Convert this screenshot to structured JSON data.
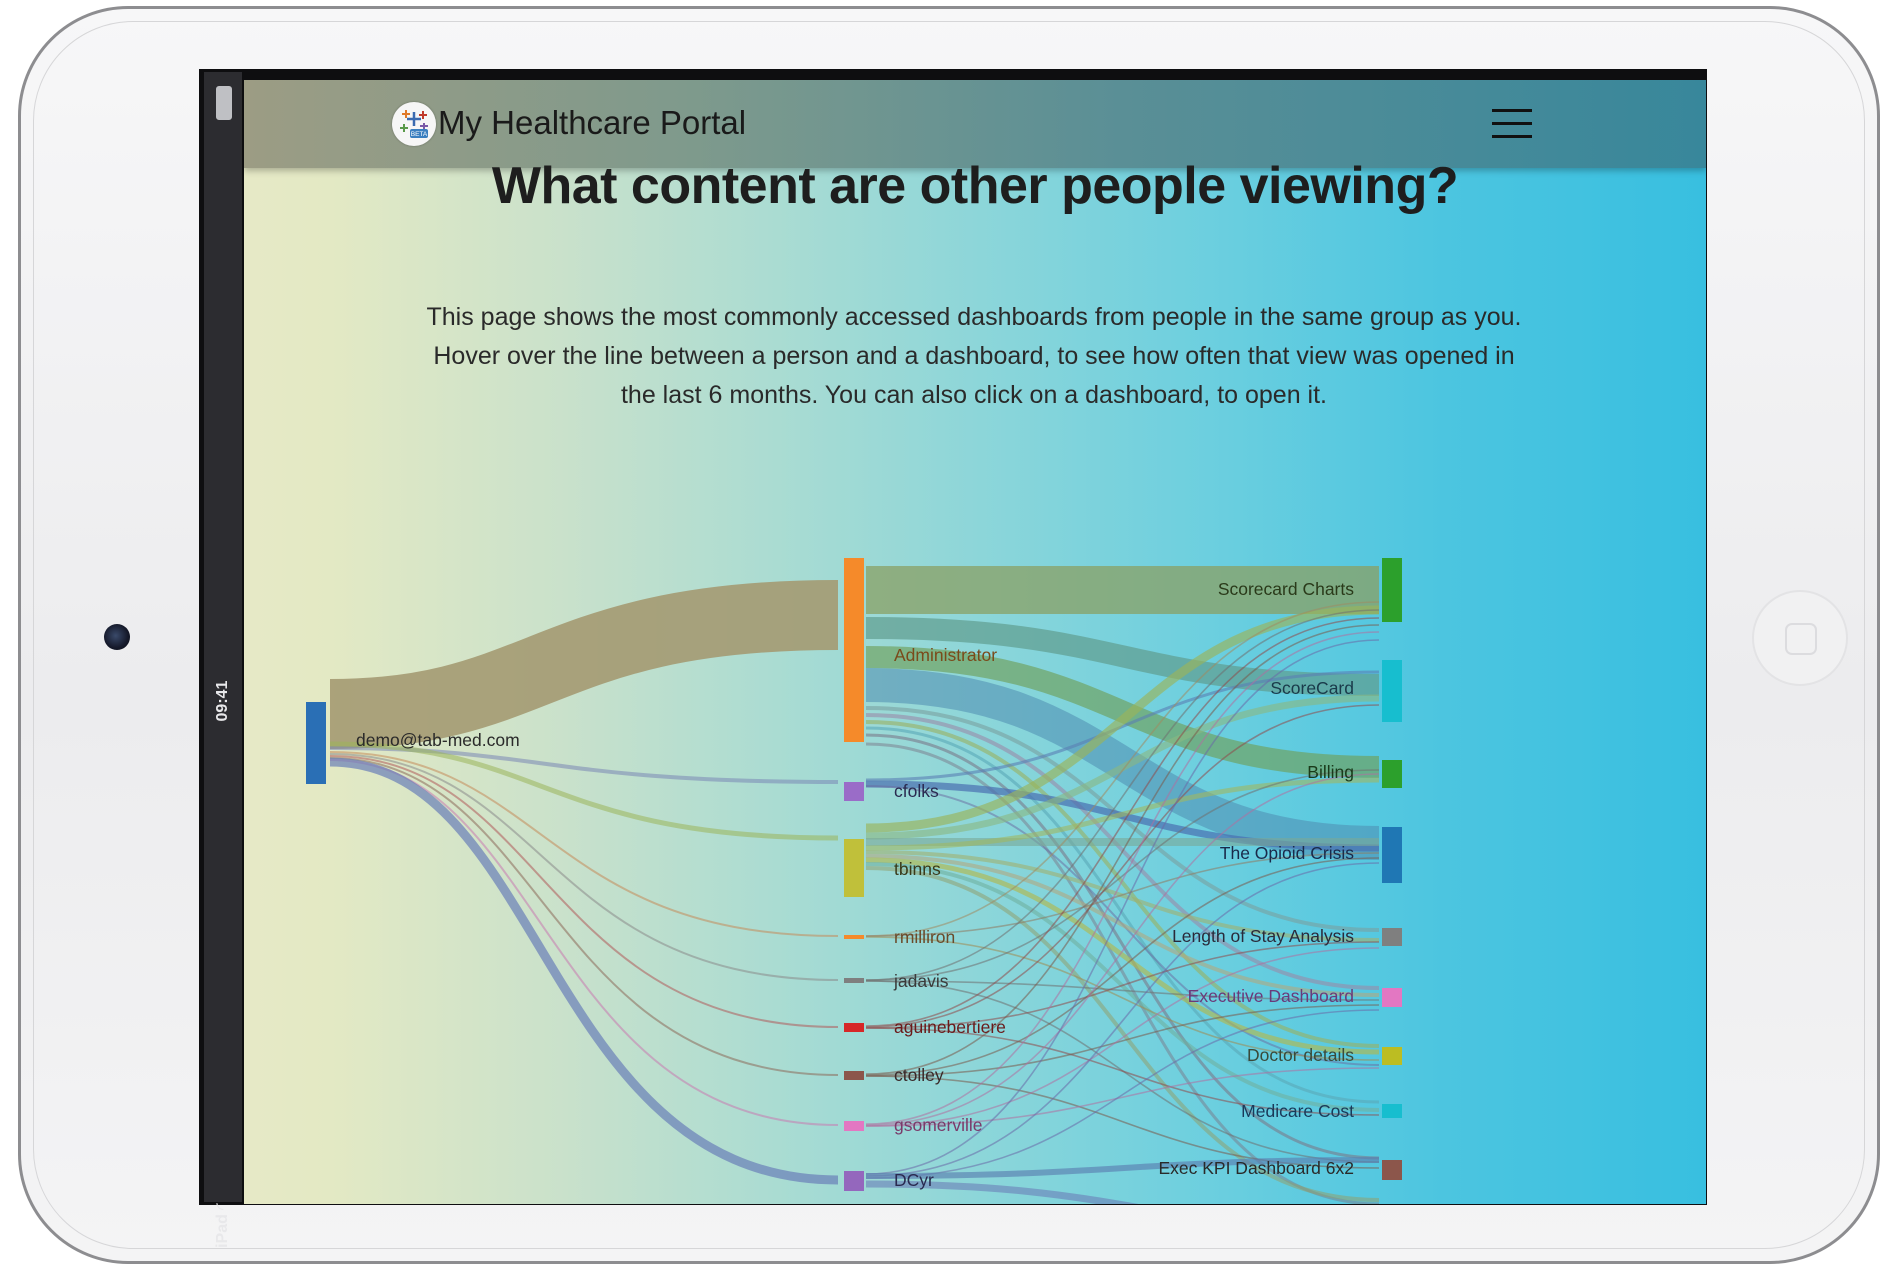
{
  "device": {
    "status_time": "09:41",
    "carrier": "iPad"
  },
  "header": {
    "brand": "My Healthcare Portal",
    "logo_badge": "BETA"
  },
  "page": {
    "title": "What content are other people viewing?",
    "description": "This page shows the most commonly accessed dashboards from people in the same group as you. Hover over the line between a person and a dashboard, to see how often that view was opened in the last 6 months. You can also click on a dashboard, to open it."
  },
  "sankey": {
    "source": {
      "label": "demo@tab-med.com",
      "color": "#2a6fb5"
    },
    "users": [
      {
        "label": "Administrator",
        "color": "#f58a2a"
      },
      {
        "label": "cfolks",
        "color": "#9a6cc8"
      },
      {
        "label": "tbinns",
        "color": "#c0c03a"
      },
      {
        "label": "rmilliron",
        "color": "#f58a2a"
      },
      {
        "label": "jadavis",
        "color": "#7f7f7f"
      },
      {
        "label": "aguinebertiere",
        "color": "#d62728"
      },
      {
        "label": "ctolley",
        "color": "#8c564b"
      },
      {
        "label": "gsomerville",
        "color": "#e377c2"
      },
      {
        "label": "DCyr",
        "color": "#9467bd"
      }
    ],
    "dashboards": [
      {
        "label": "Scorecard Charts",
        "color": "#2ca02c"
      },
      {
        "label": "ScoreCard",
        "color": "#17becf"
      },
      {
        "label": "Billing",
        "color": "#2ca02c"
      },
      {
        "label": "The Opioid Crisis",
        "color": "#1f77b4"
      },
      {
        "label": "Length of Stay Analysis",
        "color": "#7f7f7f"
      },
      {
        "label": "Executive Dashboard",
        "color": "#e377c2"
      },
      {
        "label": "Doctor details",
        "color": "#bcbd22"
      },
      {
        "label": "Medicare Cost",
        "color": "#17becf"
      },
      {
        "label": "Exec KPI Dashboard 6x2",
        "color": "#8c564b"
      }
    ]
  }
}
